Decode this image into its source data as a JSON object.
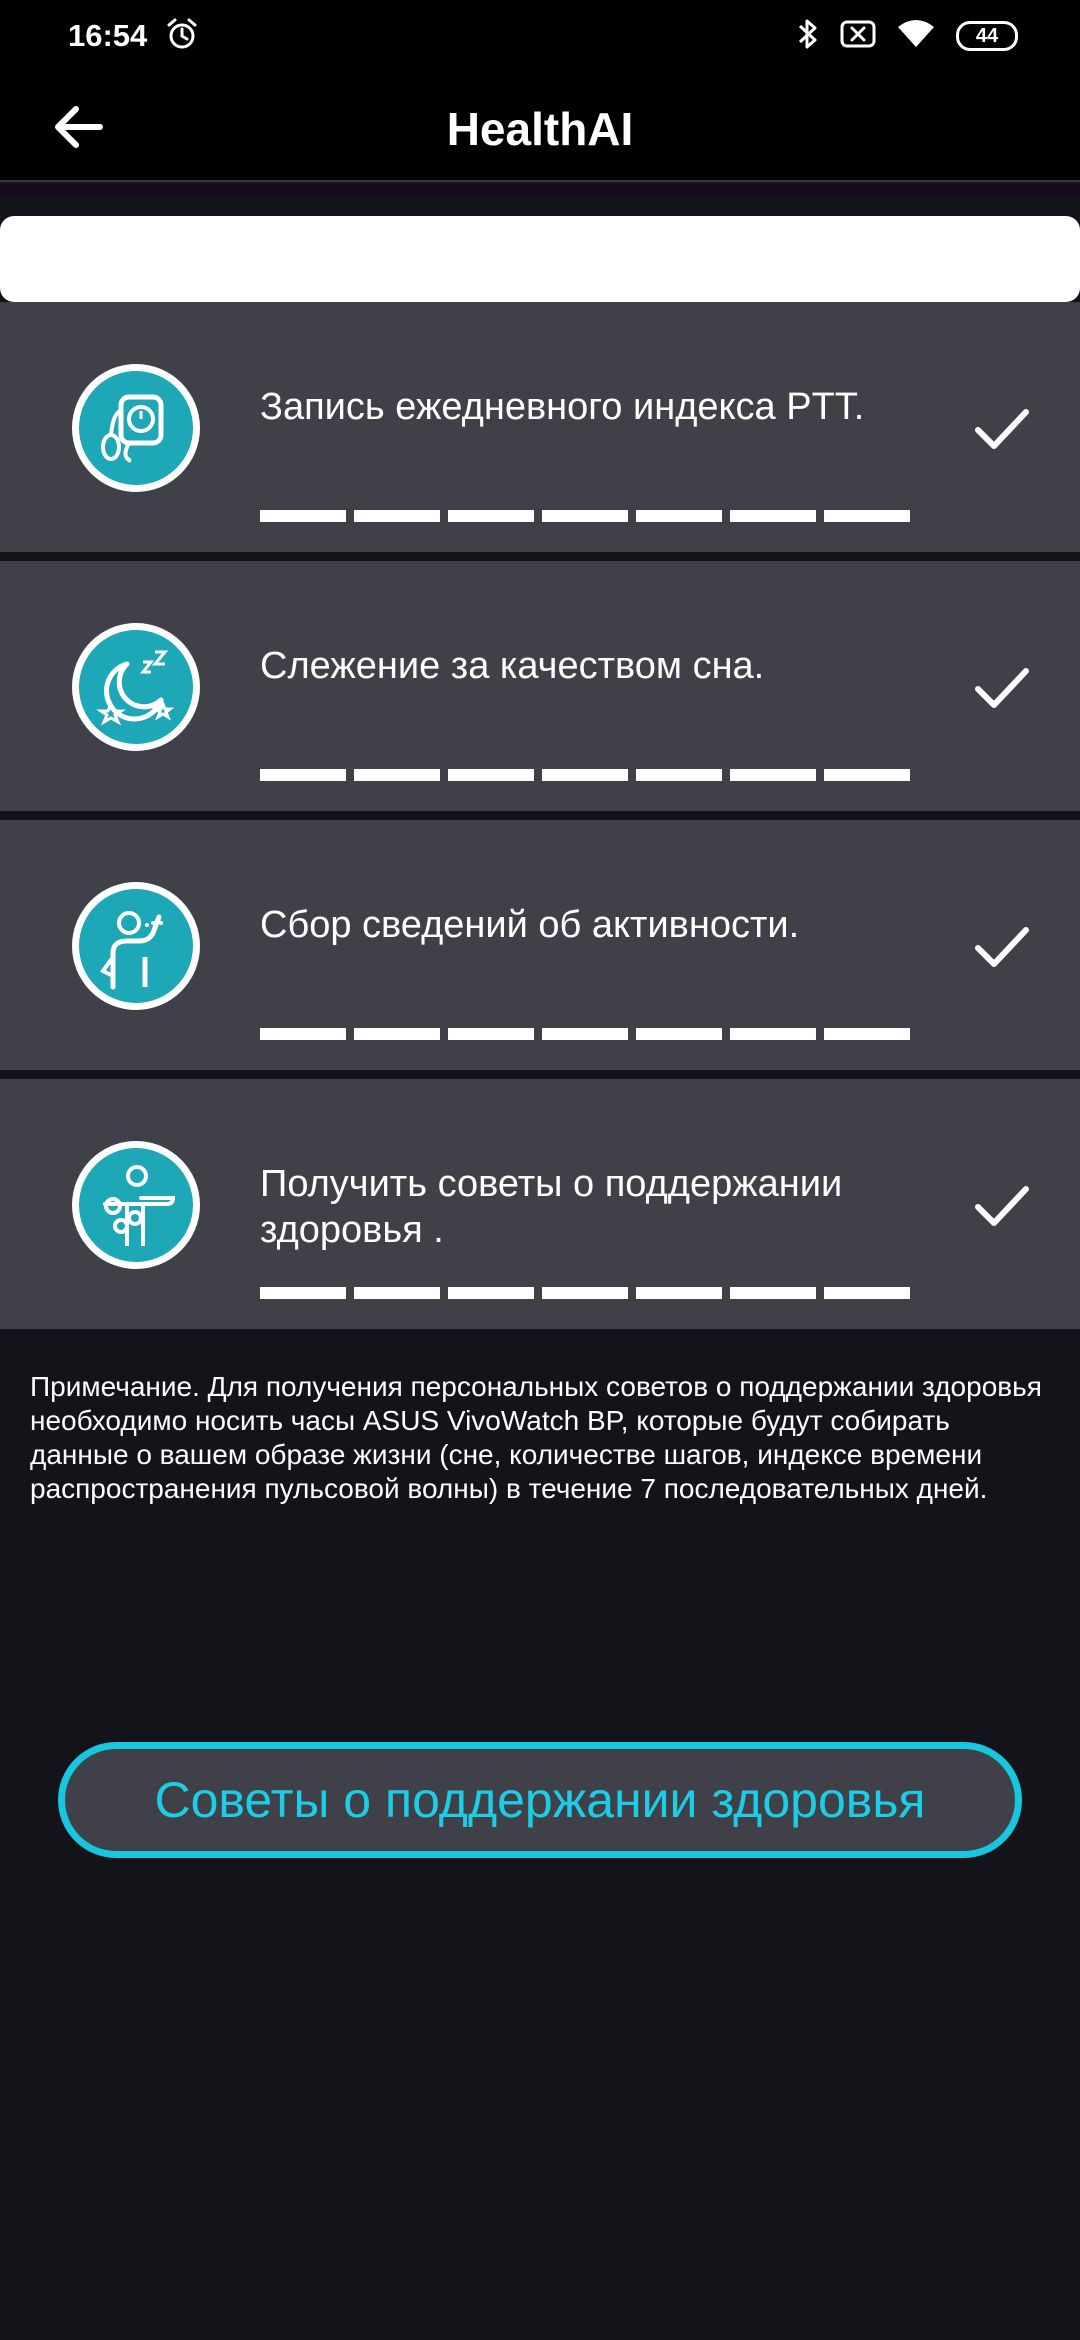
{
  "status_bar": {
    "time": "16:54",
    "battery": "44",
    "icons": [
      "alarm-icon",
      "bluetooth-icon",
      "sim-disabled-icon",
      "wifi-icon",
      "battery-icon"
    ]
  },
  "app_bar": {
    "title": "HealthAI",
    "back_icon": "arrow-left-icon"
  },
  "steps": [
    {
      "label": "Запись ежедневного индекса PTT.",
      "icon": "blood-pressure-monitor-icon",
      "completed": true,
      "progress_segments": 7
    },
    {
      "label": "Слежение за качеством сна.",
      "icon": "sleep-moon-icon",
      "completed": true,
      "progress_segments": 7
    },
    {
      "label": "Сбор сведений об активности.",
      "icon": "activity-person-icon",
      "completed": true,
      "progress_segments": 7
    },
    {
      "label": "Получить советы о поддержании здоровья .",
      "icon": "health-advice-person-icon",
      "completed": true,
      "progress_segments": 7
    }
  ],
  "note": "Примечание. Для получения персональных советов о поддержании здоровья необходимо носить часы ASUS VivoWatch BP, которые будут собирать данные о вашем образе жизни (сне, количестве шагов, индексе времени распространения пульсовой волны) в течение 7 последовательных дней.",
  "cta_button": "Советы о поддержании здоровья",
  "colors": {
    "accent": "#17c7df",
    "icon_bg": "#1ea7b7",
    "card_bg": "#404148",
    "page_bg": "#131419"
  }
}
